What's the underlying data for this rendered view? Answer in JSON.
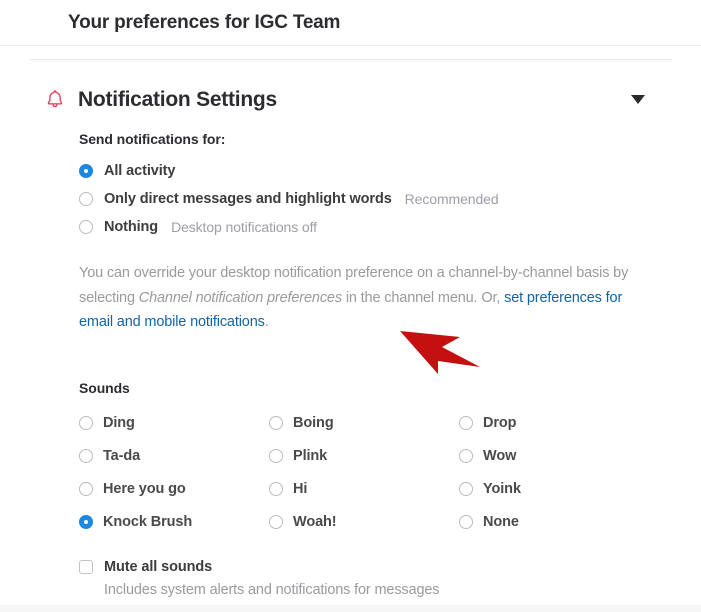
{
  "header": {
    "title": "Your preferences for IGC Team"
  },
  "section": {
    "icon": "bell-icon",
    "title": "Notification Settings",
    "collapse_icon": "chevron-down-icon"
  },
  "notifications": {
    "label": "Send notifications for:",
    "options": [
      {
        "label": "All activity",
        "hint": "",
        "checked": true
      },
      {
        "label": "Only direct messages and highlight words",
        "hint": "Recommended",
        "checked": false
      },
      {
        "label": "Nothing",
        "hint": "Desktop notifications off",
        "checked": false
      }
    ],
    "description": {
      "part1": "You can override your desktop notification preference on a channel-by-channel basis by selecting ",
      "italic": "Channel notification preferences",
      "part2": " in the channel menu. Or, ",
      "link": "set preferences for email and mobile notifications",
      "part3": "."
    }
  },
  "sounds": {
    "label": "Sounds",
    "options": [
      {
        "label": "Ding",
        "checked": false
      },
      {
        "label": "Boing",
        "checked": false
      },
      {
        "label": "Drop",
        "checked": false
      },
      {
        "label": "Ta-da",
        "checked": false
      },
      {
        "label": "Plink",
        "checked": false
      },
      {
        "label": "Wow",
        "checked": false
      },
      {
        "label": "Here you go",
        "checked": false
      },
      {
        "label": "Hi",
        "checked": false
      },
      {
        "label": "Yoink",
        "checked": false
      },
      {
        "label": "Knock Brush",
        "checked": true
      },
      {
        "label": "Woah!",
        "checked": false
      },
      {
        "label": "None",
        "checked": false
      }
    ]
  },
  "mute": {
    "label": "Mute all sounds",
    "sublabel": "Includes system alerts and notifications for messages",
    "checked": false
  },
  "annotation": {
    "name": "red-arrow-pointer"
  },
  "colors": {
    "accent_blue": "#1d87e4",
    "link_blue": "#1264a3",
    "bell_red": "#e8344e",
    "annotation_red": "#c41010",
    "text_dark": "#2c2d30",
    "text_muted": "#9a9a9f"
  }
}
